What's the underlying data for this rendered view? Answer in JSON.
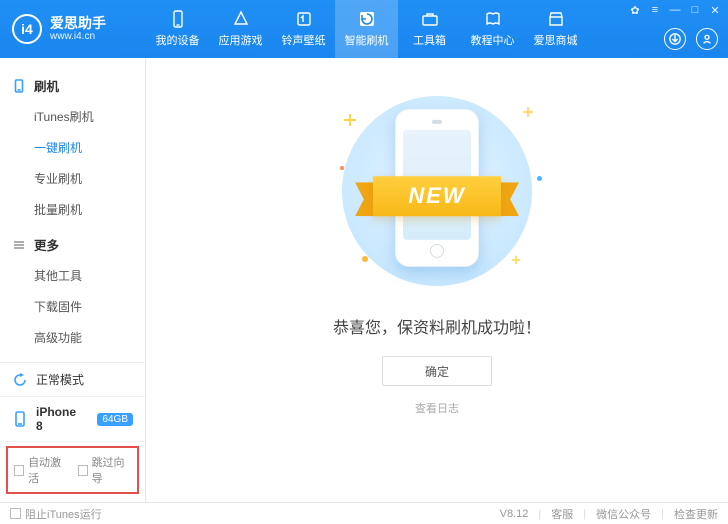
{
  "brand": {
    "title": "爱思助手",
    "url": "www.i4.cn",
    "logo_text": "i4"
  },
  "nav": [
    {
      "id": "device",
      "label": "我的设备"
    },
    {
      "id": "games",
      "label": "应用游戏"
    },
    {
      "id": "ring",
      "label": "铃声壁纸"
    },
    {
      "id": "flash",
      "label": "智能刷机"
    },
    {
      "id": "toolbox",
      "label": "工具箱"
    },
    {
      "id": "tutorial",
      "label": "教程中心"
    },
    {
      "id": "store",
      "label": "爱思商城"
    }
  ],
  "nav_active": "flash",
  "sidebar": {
    "sections": [
      {
        "id": "flash",
        "head": "刷机",
        "head_icon": "phone",
        "items": [
          {
            "id": "itunes",
            "label": "iTunes刷机"
          },
          {
            "id": "onekey",
            "label": "一键刷机",
            "active": true
          },
          {
            "id": "pro",
            "label": "专业刷机"
          },
          {
            "id": "batch",
            "label": "批量刷机"
          }
        ]
      },
      {
        "id": "more",
        "head": "更多",
        "head_icon": "list",
        "items": [
          {
            "id": "othertools",
            "label": "其他工具"
          },
          {
            "id": "fwdl",
            "label": "下载固件"
          },
          {
            "id": "adv",
            "label": "高级功能"
          }
        ]
      }
    ],
    "status": [
      {
        "id": "mode",
        "icon": "refresh",
        "label": "正常模式"
      },
      {
        "id": "device",
        "icon": "phone",
        "label": "iPhone 8",
        "badge": "64GB"
      }
    ],
    "checks": [
      {
        "id": "autoactivate",
        "label": "自动激活"
      },
      {
        "id": "skipguide",
        "label": "跳过向导"
      }
    ]
  },
  "main": {
    "ribbon_text": "NEW",
    "success": "恭喜您，保资料刷机成功啦！",
    "ok": "确定",
    "log": "查看日志"
  },
  "footer": {
    "block_itunes": "阻止iTunes运行",
    "version": "V8.12",
    "support": "客服",
    "wechat": "微信公众号",
    "update": "检查更新"
  }
}
